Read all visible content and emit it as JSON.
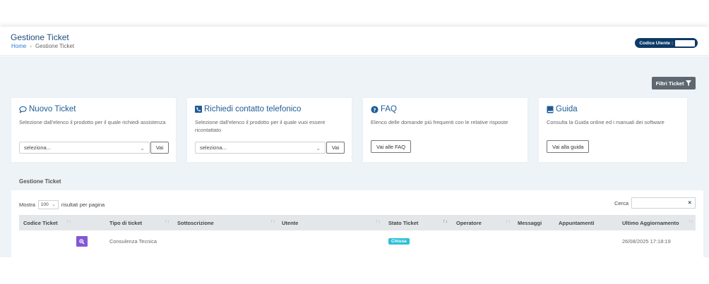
{
  "header": {
    "title": "Gestione Ticket",
    "breadcrumb": [
      "Home",
      "Gestione Ticket"
    ],
    "user_code_label": "Codice Utente :"
  },
  "toolbar": {
    "filter_label": "Filtri Ticket"
  },
  "cards": [
    {
      "title": "Nuovo Ticket",
      "icon": "comment-icon",
      "description": "Selezione dall'elenco il prodotto per il quale richiedi assistenza",
      "select_value": "seleziona...",
      "button_label": "Vai"
    },
    {
      "title": "Richiedi contatto telefonico",
      "icon": "phone-square-icon",
      "description": "Selezione dall'elenco il prodotto per il quale vuoi essere ricontattato",
      "select_value": "seleziona...",
      "button_label": "Vai"
    },
    {
      "title": "FAQ",
      "icon": "question-circle-icon",
      "description": "Elenco delle domande più frequenti con le relative risposte",
      "button_label": "Vai alle FAQ"
    },
    {
      "title": "Guida",
      "icon": "book-icon",
      "description": "Consulta la Guida online ed i manuali dei software",
      "button_label": "Vai alla guida"
    }
  ],
  "table_section": {
    "title": "Gestione Ticket",
    "show_label": "Mostra",
    "page_size": "100",
    "per_page_label": "risultati per pagina",
    "search_label": "Cerca",
    "search_value": "",
    "columns": [
      "Codice Ticket",
      "Tipo di ticket",
      "Sottoscrizione",
      "Utente",
      "Stato Ticket",
      "Operatore",
      "Messaggi",
      "Appuntamenti",
      "Ultimo Aggiornamento"
    ],
    "rows": [
      {
        "codice": "",
        "tipo": "Consulenza Tecnica",
        "sottoscrizione": "",
        "utente": "",
        "stato": "Chiusa",
        "operatore": "",
        "messaggi": "",
        "appuntamenti": "",
        "ultimo_aggiornamento": "26/08/2025 17:18:19"
      }
    ]
  },
  "colors": {
    "brand_dark": "#0d3a66",
    "title_blue": "#1f5c96",
    "status_closed": "#2ec0d6",
    "view_button": "#8257d6",
    "filter_button": "#5f6870"
  }
}
